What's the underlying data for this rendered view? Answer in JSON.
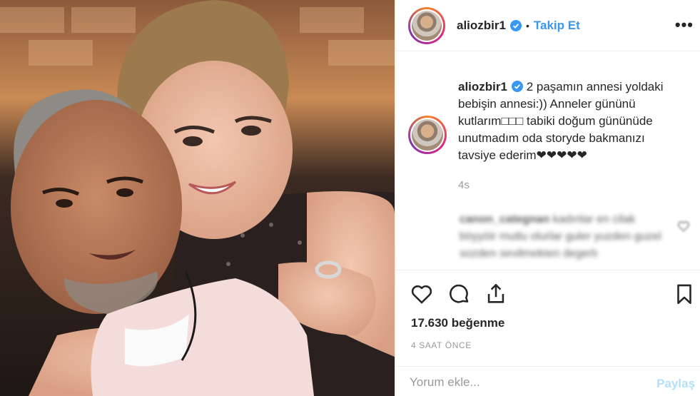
{
  "post": {
    "username": "aliozbir1",
    "follow_label": "Takip Et",
    "more_label": "•••",
    "caption_lines": [
      "2 paşamın annesi yoldaki",
      "bebişin annesi:)) Anneler gününü",
      "kutlarım□□□ tabiki doğum gününüde",
      "unutmadım oda storyde bakmanızı",
      "tavsiye ederim❤❤❤❤❤"
    ],
    "caption_time": "4s",
    "blurred_comment": {
      "username": "canon_categnan",
      "text": "kadınlar en cilak böyyöir mutlu olurlar guler yuzden guzel sozden sevilmekten degerlı"
    },
    "likes": "17.630 beğenme",
    "time_ago": "4 SAAT ÖNCE",
    "comment_placeholder": "Yorum ekle...",
    "share_label": "Paylaş"
  },
  "colors": {
    "accent": "#3897f0",
    "muted": "#999999",
    "share_disabled": "#b2dffc",
    "border": "#efefef"
  },
  "icons": [
    "verified-badge-icon",
    "heart-icon",
    "comment-icon",
    "share-icon",
    "bookmark-icon"
  ]
}
